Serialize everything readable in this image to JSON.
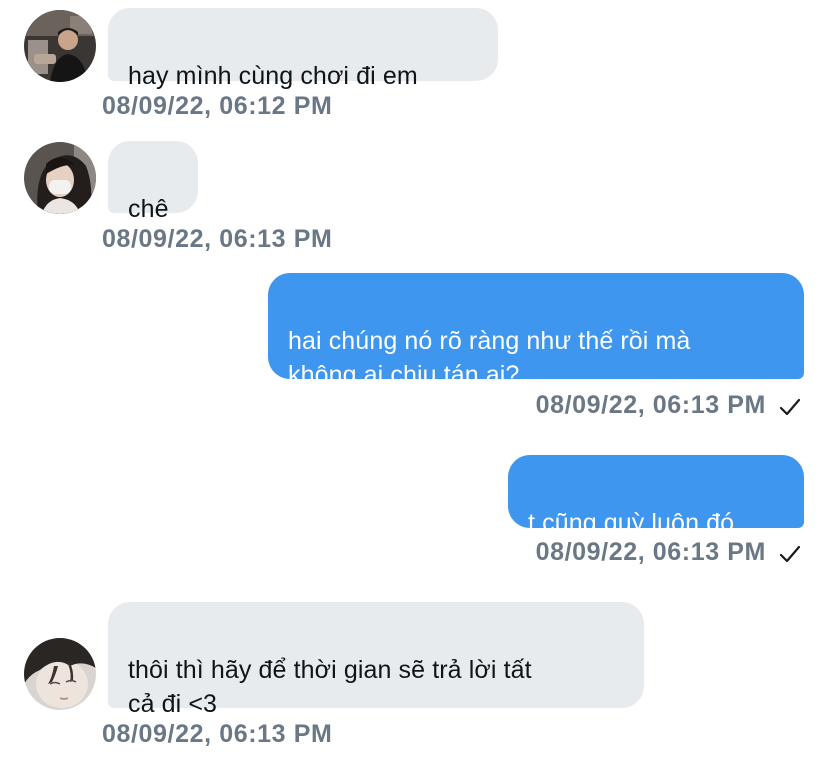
{
  "messages": [
    {
      "sender": "other",
      "avatar": "avatar-man-dark-shirt",
      "text": "hay mình cùng chơi đi em",
      "timestamp": "08/09/22, 06:12 PM"
    },
    {
      "sender": "other",
      "avatar": "avatar-girl-white-mask",
      "text": "chê",
      "timestamp": "08/09/22, 06:13 PM"
    },
    {
      "sender": "me",
      "text": "hai chúng nó rõ ràng như thế rồi mà\nkhông ai chịu tán ai?",
      "timestamp": "08/09/22, 06:13 PM",
      "status": "check-icon"
    },
    {
      "sender": "me",
      "text": "t cũng quỳ luôn đó",
      "timestamp": "08/09/22, 06:13 PM",
      "status": "check-icon"
    },
    {
      "sender": "other",
      "avatar": "avatar-boy-face-closeup",
      "text": "thôi thì hãy để thời gian sẽ trả lời tất\ncả đi <3",
      "timestamp": "08/09/22, 06:13 PM"
    }
  ],
  "colors": {
    "incoming_bubble": "#e8ebee",
    "outgoing_bubble": "#3e96ee",
    "timestamp": "#6a7785"
  }
}
